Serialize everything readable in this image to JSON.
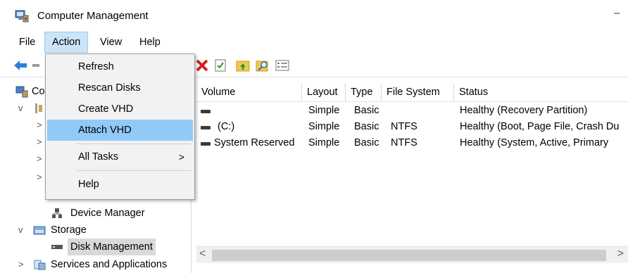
{
  "window": {
    "title": "Computer Management",
    "minimize_glyph": "–"
  },
  "menubar": {
    "items": [
      {
        "label": "File"
      },
      {
        "label": "Action"
      },
      {
        "label": "View"
      },
      {
        "label": "Help"
      }
    ]
  },
  "toolbar": {
    "buttons": [
      "back-arrow-icon",
      "delete-icon",
      "properties-icon",
      "up-folder-icon",
      "search-icon",
      "view-icon"
    ]
  },
  "action_menu": {
    "items": [
      {
        "label": "Refresh"
      },
      {
        "label": "Rescan Disks"
      },
      {
        "label": "Create VHD"
      },
      {
        "label": "Attach VHD",
        "highlighted": true
      },
      {
        "label": "All Tasks",
        "submenu_glyph": ">"
      },
      {
        "label": "Help"
      }
    ]
  },
  "tree": {
    "root": "Co",
    "system_tools_chevron": "v",
    "partial_rows": [
      ">",
      ">",
      ">",
      ">"
    ],
    "device_manager": "Device Manager",
    "storage": "Storage",
    "storage_chevron": "v",
    "disk_management": "Disk Management",
    "services": "Services and Applications",
    "services_chevron": ">"
  },
  "table": {
    "headers": [
      "Volume",
      "Layout",
      "Type",
      "File System",
      "Status"
    ],
    "rows": [
      {
        "volume": "",
        "layout": "Simple",
        "type": "Basic",
        "fs": "",
        "status": "Healthy (Recovery Partition)"
      },
      {
        "volume": "(C:)",
        "layout": "Simple",
        "type": "Basic",
        "fs": "NTFS",
        "status": "Healthy (Boot, Page File, Crash Du"
      },
      {
        "volume": "System Reserved",
        "layout": "Simple",
        "type": "Basic",
        "fs": "NTFS",
        "status": "Healthy (System, Active, Primary"
      }
    ]
  },
  "scrollbar": {
    "left": "<",
    "right": ">"
  }
}
